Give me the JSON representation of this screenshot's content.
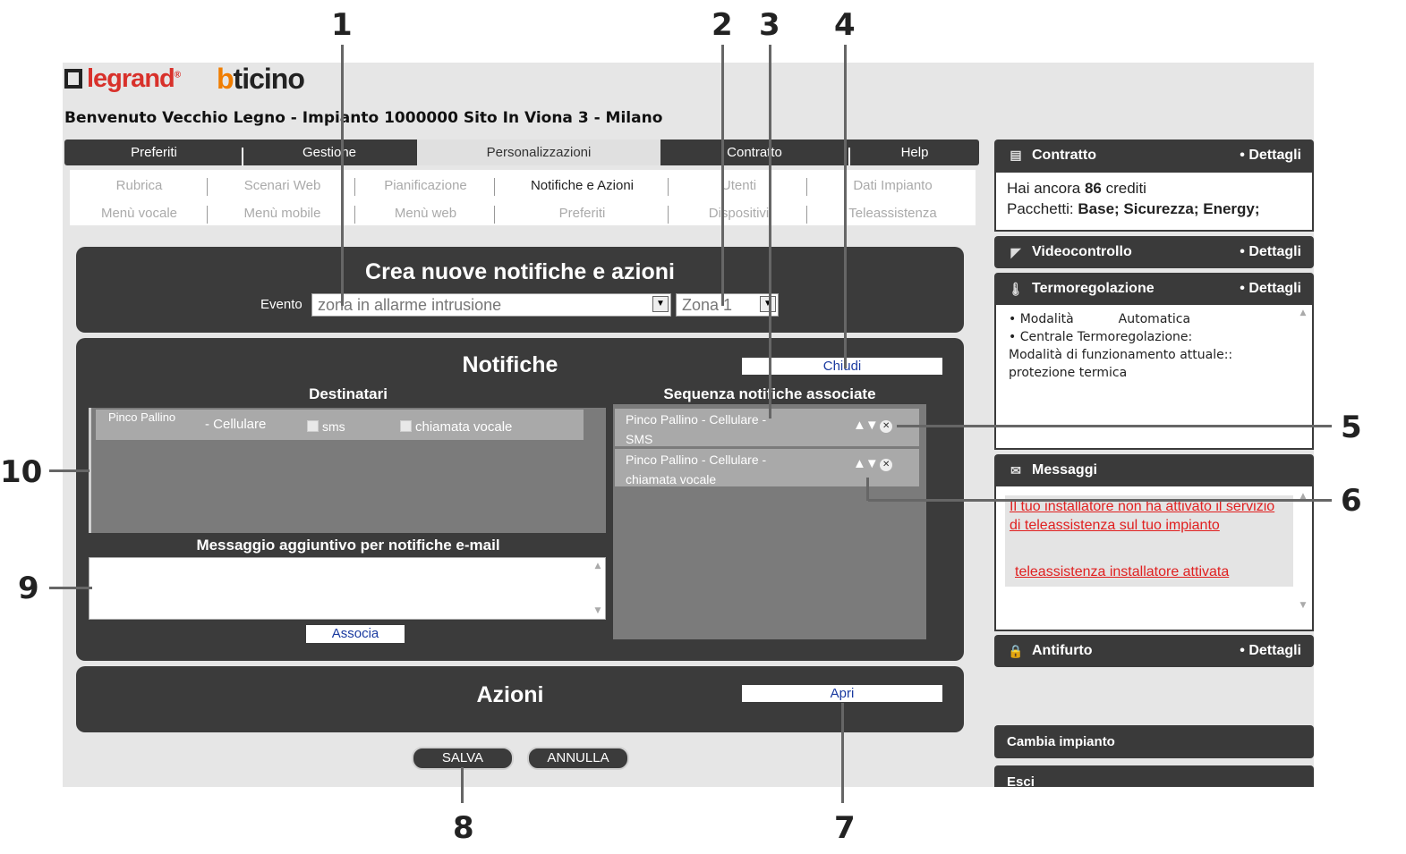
{
  "callouts": [
    "1",
    "2",
    "3",
    "4",
    "5",
    "6",
    "7",
    "8",
    "9",
    "10"
  ],
  "brand": {
    "legrand": "legrand",
    "legrand_mark": "®",
    "bticino_b": "b",
    "bticino_rest": "ticino"
  },
  "welcome": "Benvenuto Vecchio Legno - Impianto 1000000 Sito In Viona 3 - Milano",
  "tabs": [
    "Preferiti",
    "Gestione",
    "Personalizzazioni",
    "Contratto",
    "Help"
  ],
  "subnav": {
    "row1": [
      "Rubrica",
      "Scenari Web",
      "Pianificazione",
      "Notifiche e Azioni",
      "Utenti",
      "Dati Impianto"
    ],
    "row2": [
      "Menù vocale",
      "Menù mobile",
      "Menù web",
      "Preferiti",
      "Dispositivi",
      "Teleassistenza"
    ]
  },
  "crea": {
    "title": "Crea nuove notifiche e azioni",
    "evento_label": "Evento",
    "evento_value": "zona in allarme intrusione",
    "zona_value": "Zona 1"
  },
  "notifiche": {
    "title": "Notifiche",
    "chiudi": "Chiudi",
    "destinatari": "Destinatari",
    "sequenza": "Sequenza notifiche associate",
    "dest_row": {
      "name": "Pinco Pallino",
      "device": "- Cellulare",
      "opt1": "sms",
      "opt2": "chiamata vocale"
    },
    "seq": [
      {
        "line1": "Pinco Pallino - Cellulare -",
        "line2": "SMS"
      },
      {
        "line1": "Pinco Pallino - Cellulare -",
        "line2": "chiamata vocale"
      }
    ],
    "messaggio_label": "Messaggio aggiuntivo per notifiche e-mail",
    "associa": "Associa"
  },
  "azioni": {
    "title": "Azioni",
    "apri": "Apri"
  },
  "buttons": {
    "salva": "SALVA",
    "annulla": "ANNULLA"
  },
  "sidebar": {
    "contratto": {
      "title": "Contratto",
      "dettagli": "• Dettagli",
      "credit_pre": "Hai ancora",
      "credit_num": "86",
      "credit_post": "crediti",
      "pacchetti_label": "Pacchetti:",
      "pacchetti_value": "Base; Sicurezza; Energy;"
    },
    "video": {
      "title": "Videocontrollo",
      "dettagli": "• Dettagli"
    },
    "termo": {
      "title": "Termoregolazione",
      "dettagli": "• Dettagli",
      "l1a": "• Modalità",
      "l1b": "Automatica",
      "l2": "• Centrale Termoregolazione:",
      "l3": "Modalità di funzionamento attuale::",
      "l4": "protezione termica"
    },
    "messaggi": {
      "title": "Messaggi",
      "m1": "Il tuo installatore non ha attivato il servizio di teleassistenza sul tuo impianto",
      "m2": "teleassistenza installatore attivata"
    },
    "antifurto": {
      "title": "Antifurto",
      "dettagli": "• Dettagli"
    },
    "cambia": "Cambia impianto",
    "esci": "Esci"
  },
  "colors": {
    "dark_panel": "#3b3b3b",
    "brand_red": "#d8312b",
    "brand_orange": "#f07d00",
    "link_blue": "#1a3aa0",
    "alert_red": "#e02020"
  }
}
